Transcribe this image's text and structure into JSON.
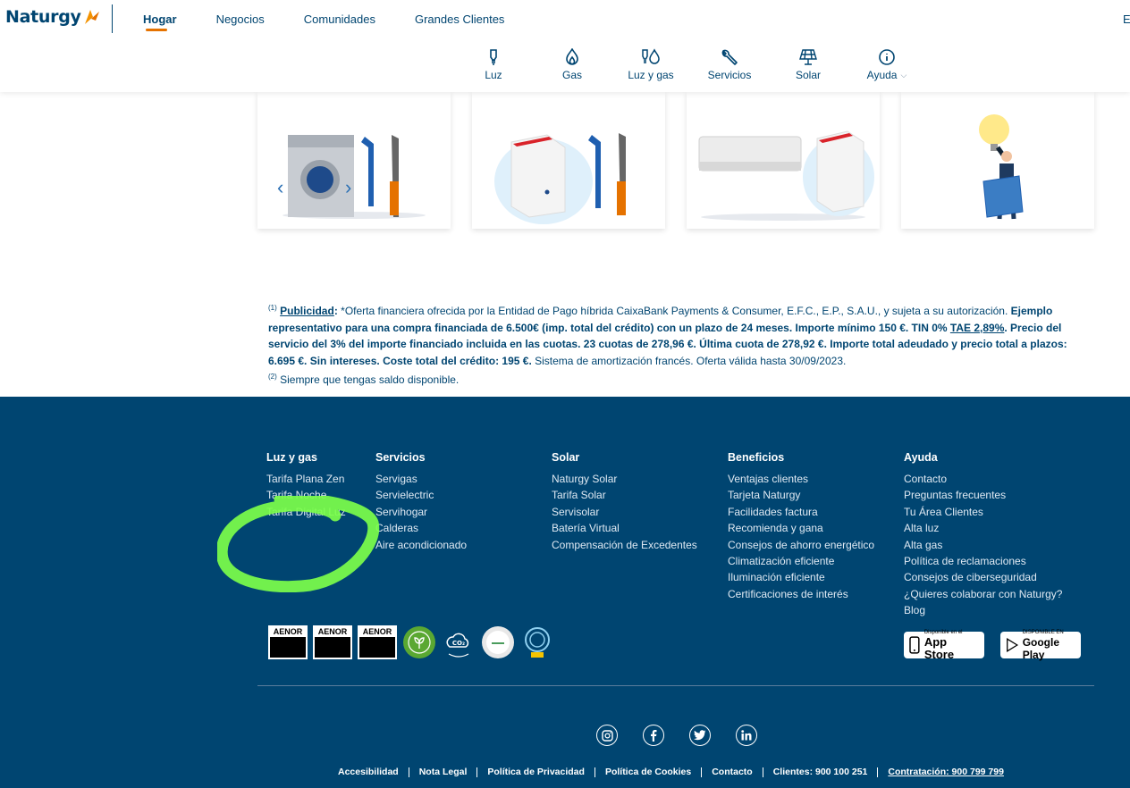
{
  "header": {
    "logo_text": "Naturgy",
    "top_nav": [
      "Hogar",
      "Negocios",
      "Comunidades",
      "Grandes Clientes"
    ],
    "active_top": "Hogar",
    "lang_partial": "E",
    "categories": [
      {
        "label": "Luz",
        "icon": "bulb-icon"
      },
      {
        "label": "Gas",
        "icon": "flame-icon"
      },
      {
        "label": "Luz y gas",
        "icon": "bulb-flame-icon"
      },
      {
        "label": "Servicios",
        "icon": "wrench-icon"
      },
      {
        "label": "Solar",
        "icon": "solar-panel-icon"
      },
      {
        "label": "Ayuda",
        "icon": "info-icon"
      }
    ]
  },
  "legal": {
    "note1": "(1)",
    "publicidad": "Publicidad",
    "colon": ":",
    "text1": " *Oferta financiera ofrecida por la Entidad de Pago híbrida CaixaBank Payments & Consumer, E.F.C., E.P., S.A.U., y sujeta a su autorización. ",
    "bold1": "Ejemplo representativo para una compra financiada de 6.500€ (imp. total del crédito) con un plazo de 24 meses. Importe mínimo 150 €. TIN 0% ",
    "tae": "TAE 2,89%",
    "bold2": ". Precio del servicio del 3% del importe financiado incluida en las cuotas. 23 cuotas de 278,96 €. Última cuota de 278,92 €. Importe total adeudado y precio total a plazos: 6.695 €. Sin intereses. Coste total del crédito: 195 €.",
    "text2": " Sistema de amortización francés. Oferta válida hasta 30/09/2023.",
    "note2": "(2)",
    "text3": " Siempre que tengas saldo disponible."
  },
  "footer": {
    "columns": [
      {
        "title": "Luz y gas",
        "links": [
          "Tarifa Plana Zen",
          "Tarifa Noche",
          "Tarifa Digital Luz"
        ]
      },
      {
        "title": "Servicios",
        "links": [
          "Servigas",
          "Servielectric",
          "Servihogar",
          "Calderas",
          "Aire acondicionado"
        ]
      },
      {
        "title": "Solar",
        "links": [
          "Naturgy Solar",
          "Tarifa Solar",
          "Servisolar",
          "Batería Virtual",
          "Compensación de Excedentes"
        ]
      },
      {
        "title": "Beneficios",
        "links": [
          "Ventajas clientes",
          "Tarjeta Naturgy",
          "Facilidades factura",
          "Recomienda y gana",
          "Consejos de ahorro energético",
          "Climatización eficiente",
          "Iluminación eficiente",
          "Certificaciones de interés"
        ]
      },
      {
        "title": "Ayuda",
        "links": [
          "Contacto",
          "Preguntas frecuentes",
          "Tu Área Clientes",
          "Alta luz",
          "Alta gas",
          "Política de reclamaciones",
          "Consejos de ciberseguridad",
          "¿Quieres colaborar con Naturgy?",
          "Blog"
        ]
      }
    ],
    "badges": {
      "aenor": "AENOR",
      "co2": "CO2 neutro"
    },
    "app_store": {
      "small": "Disponible en el",
      "big": "App Store"
    },
    "google_play": {
      "small": "DISPONIBLE EN",
      "big": "Google Play"
    },
    "bottom_links": [
      "Accesibilidad",
      "Nota Legal",
      "Política de Privacidad",
      "Política de Cookies",
      "Contacto",
      "Clientes: 900 100 251",
      "Contratación: 900 799 799"
    ]
  },
  "colors": {
    "navy": "#004571",
    "orange": "#e57200",
    "highlight_green": "#7CFF4A"
  }
}
